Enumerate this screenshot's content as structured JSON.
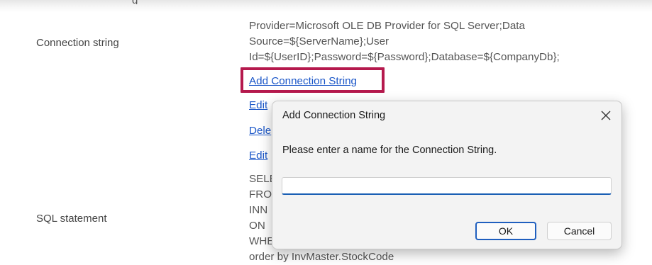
{
  "background_header": {
    "cut_label": "g"
  },
  "properties": {
    "connection_string": {
      "label": "Connection string",
      "value": "Provider=Microsoft OLE DB Provider for SQL Server;Data\nSource=${ServerName};User\nId=${UserID};Password=${Password};Database=${CompanyDb};"
    },
    "links": {
      "add": "Add Connection String",
      "edit1": "Edit",
      "delete": "Dele",
      "edit2": "Edit"
    },
    "sql_statement": {
      "label": "SQL statement",
      "value": "SELE\nFRO\nINN\nON\nWHE\norder by InvMaster.StockCode"
    }
  },
  "dialog": {
    "title": "Add Connection String",
    "prompt": "Please enter a name for the Connection String.",
    "input_value": "",
    "ok_label": "OK",
    "cancel_label": "Cancel",
    "close_icon": "close-icon"
  },
  "colors": {
    "link": "#1a56c8",
    "highlight": "#b5194d",
    "ok_border": "#1f5fbf"
  }
}
